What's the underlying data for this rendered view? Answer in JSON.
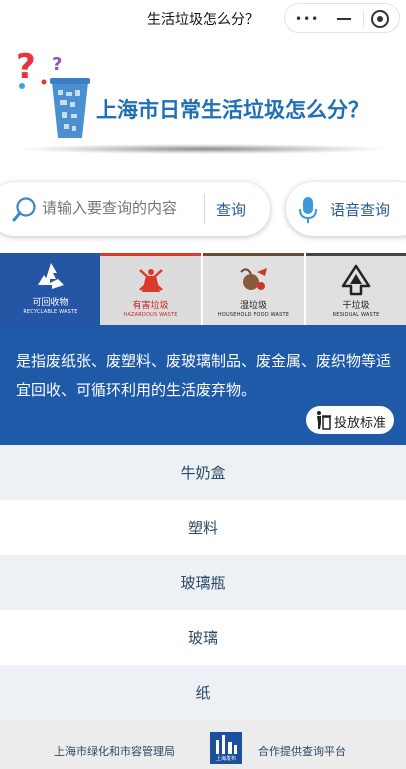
{
  "window": {
    "title": "生活垃圾怎么分？"
  },
  "banner": {
    "title": "上海市日常生活垃圾怎么分？"
  },
  "search": {
    "placeholder": "请输入要查询的内容",
    "button_label": "查询",
    "voice_label": "语音查询"
  },
  "categories": [
    {
      "name_cn": "可回收物",
      "name_en": "RECYCLABLE WASTE",
      "color": "#2556a6",
      "icon": "recycle-icon",
      "selected": true
    },
    {
      "name_cn": "有害垃圾",
      "name_en": "HAZARDOUS WASTE",
      "color": "#d83b2b",
      "icon": "hazardous-icon",
      "selected": false
    },
    {
      "name_cn": "湿垃圾",
      "name_en": "HOUSEHOLD FOOD WASTE",
      "color": "#6b4a34",
      "icon": "food-waste-icon",
      "selected": false
    },
    {
      "name_cn": "干垃圾",
      "name_en": "RESIDUAL WASTE",
      "color": "#444444",
      "icon": "residual-icon",
      "selected": false
    }
  ],
  "description": {
    "text": "是指废纸张、废塑料、废玻璃制品、废金属、废织物等适宜回收、可循环利用的生活废弃物。",
    "disposal_button_label": "投放标准"
  },
  "items": [
    "牛奶盒",
    "塑料",
    "玻璃瓶",
    "玻璃",
    "纸"
  ],
  "footer": {
    "left_text": "上海市绿化和市容管理局",
    "logo_text": "上海发布",
    "right_text": "合作提供查询平台"
  },
  "colors": {
    "accent": "#1e5aa8",
    "title_blue": "#1f6fb5",
    "list_text": "#2c4866"
  }
}
